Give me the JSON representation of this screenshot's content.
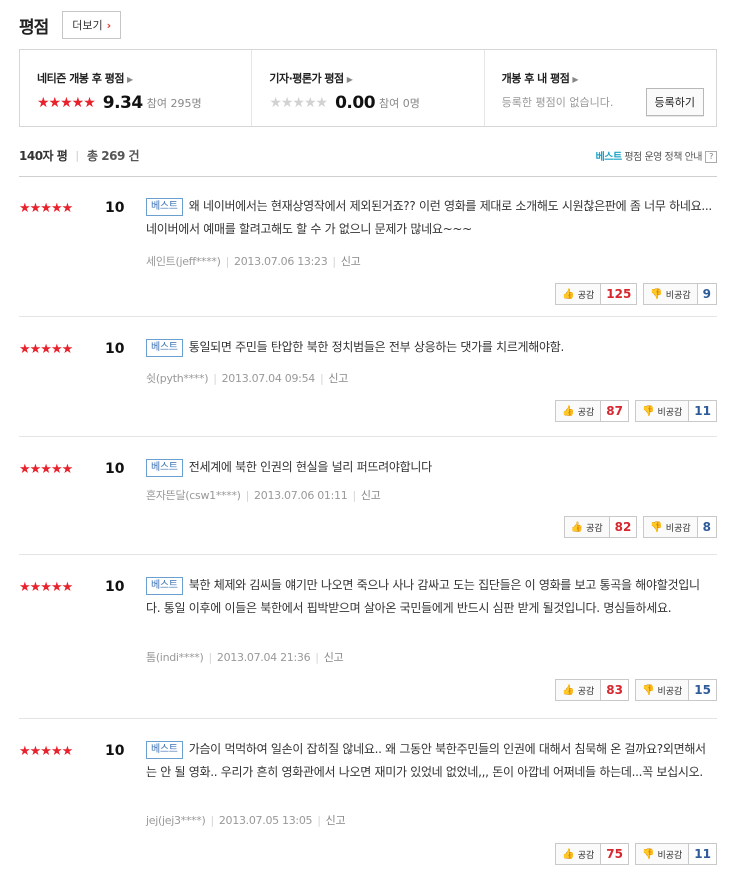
{
  "header": {
    "title": "평점",
    "more_label": "더보기"
  },
  "summary": {
    "netizen": {
      "label": "네티즌 개봉 후 평점",
      "score": "9.34",
      "participants": "참여 295명",
      "stars": "★★★★★"
    },
    "critic": {
      "label": "기자·평론가 평점",
      "score": "0.00",
      "participants": "참여 0명",
      "stars": "★★★★★"
    },
    "before": {
      "label": "개봉 후 내 평점",
      "empty_text": "등록한 평점이 없습니다.",
      "register_label": "등록하기"
    }
  },
  "count_bar": {
    "reviews_label": "140자 평",
    "total_label": "총 269 건",
    "policy_best": "베스트",
    "policy_text": "평점 운영 정책 안내",
    "policy_help": "?"
  },
  "labels": {
    "best": "베스트",
    "up": "공감",
    "down": "비공감",
    "report": "신고"
  },
  "reviews": [
    {
      "stars": "★★★★★",
      "score": "10",
      "text": "왜 네이버에서는 현재상영작에서 제외된거죠?? 이런 영화를 제대로 소개해도 시원찮은판에 좀 너무 하네요... 네이버에서 예매를 할려고해도 할 수 가 없으니 문제가 많네요~~~",
      "author": "세인트(jeff****)",
      "date": "2013.07.06 13:23",
      "up": "125",
      "down": "9"
    },
    {
      "stars": "★★★★★",
      "score": "10",
      "text": "통일되면 주민들 탄압한 북한 정치범들은 전부 상응하는 댓가를 치르게해야함.",
      "author": "쉿(pyth****)",
      "date": "2013.07.04 09:54",
      "up": "87",
      "down": "11"
    },
    {
      "stars": "★★★★★",
      "score": "10",
      "text": "전세계에 북한 인권의 현실을 널리 퍼뜨려야합니다",
      "author": "혼자뜬달(csw1****)",
      "date": "2013.07.06 01:11",
      "up": "82",
      "down": "8"
    },
    {
      "stars": "★★★★★",
      "score": "10",
      "text": "북한 체제와 김씨들 얘기만 나오면 죽으나 사나 감싸고 도는 집단들은 이 영화를 보고 통곡을 해야할것입니다. 통일 이후에 이들은 북한에서 핍박받으며 살아온 국민들에게 반드시 심판 받게 될것입니다. 명심들하세요.",
      "author": "톰(indi****)",
      "date": "2013.07.04 21:36",
      "up": "83",
      "down": "15"
    },
    {
      "stars": "★★★★★",
      "score": "10",
      "text": "가슴이 먹먹하여 일손이 잡히질 않네요.. 왜 그동안 북한주민들의 인권에 대해서 침묵해 온 걸까요?외면해서는 안 될 영화.. 우리가 흔히 영화관에서 나오면 재미가 있었네 없었네,,, 돈이 아깝네 어쩌네들 하는데...꼭 보십시오.",
      "author": "jej(jej3****)",
      "date": "2013.07.05 13:05",
      "up": "75",
      "down": "11"
    }
  ]
}
